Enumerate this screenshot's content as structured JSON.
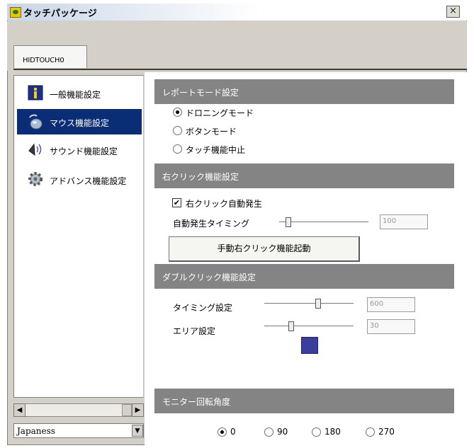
{
  "window": {
    "title": "タッチパッケージ",
    "close_glyph": "×"
  },
  "tabs": [
    {
      "label": "HIDTOUCH0"
    }
  ],
  "sidebar": {
    "items": [
      {
        "label": "一般機能設定",
        "icon": "info-icon",
        "selected": false
      },
      {
        "label": "マウス機能設定",
        "icon": "mouse-icon",
        "selected": true
      },
      {
        "label": "サウンド機能設定",
        "icon": "speaker-icon",
        "selected": false
      },
      {
        "label": "アドバンス機能設定",
        "icon": "gear-icon",
        "selected": false
      }
    ],
    "scroll_left": "◀",
    "scroll_right": "▶"
  },
  "language": {
    "value": "Japaness",
    "dropdown_glyph": "▼"
  },
  "report_mode": {
    "header": "レポートモード設定",
    "options": [
      {
        "label": "ドロニングモード",
        "checked": true
      },
      {
        "label": "ボタンモード",
        "checked": false
      },
      {
        "label": "タッチ機能中止",
        "checked": false
      }
    ]
  },
  "right_click": {
    "header": "右クリック機能設定",
    "auto_label": "右クリック自動発生",
    "auto_checked": true,
    "check_glyph": "✔",
    "timing_label": "自動発生タイミング",
    "timing_value": "100",
    "timing_level": 0.1,
    "manual_button": "手動右クリック機能起動"
  },
  "double_click": {
    "header": "ダブルクリック機能設定",
    "timing_label": "タイミング設定",
    "timing_value": "600",
    "timing_level": 0.6,
    "area_label": "エリア設定",
    "area_value": "30",
    "area_level": 0.3,
    "swatch_color": "#3a3f9e"
  },
  "monitor_rotation": {
    "header": "モニター回転角度",
    "options": [
      {
        "label": "0",
        "checked": true
      },
      {
        "label": "90",
        "checked": false
      },
      {
        "label": "180",
        "checked": false
      },
      {
        "label": "270",
        "checked": false
      }
    ]
  },
  "colors": {
    "accent_selected": "#0a2d76",
    "section_bar": "#848484",
    "window_bg": "#d4d0c8"
  }
}
